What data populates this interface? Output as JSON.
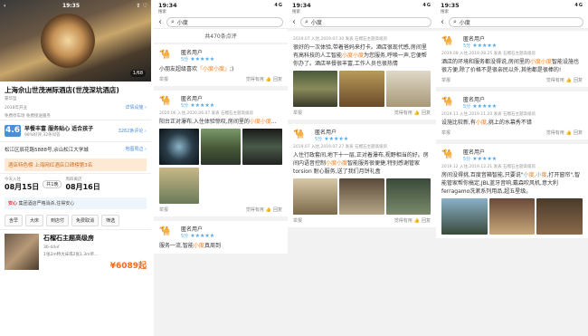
{
  "p1": {
    "time": "19:35",
    "signal": "4G",
    "photo_count": "1/68",
    "title": "上海佘山世茂洲际酒店(世茂深坑酒店)",
    "category": "豪华型",
    "opened": "2018年开业",
    "facilities": "免费停车场  免费接送服务",
    "details_link": "详情设施 ›",
    "score": "4.6",
    "score_tags": "早餐丰富  服务贴心  适合孩子",
    "score_sub": "98%好评,32条问答",
    "reviews_link": "3262条评论 ›",
    "address": "松江区辰花路5888号,佘山松江大学城",
    "map_link": "地图周边 ›",
    "banner": "酒店特色榜  上海网红酒店口碑榜第3名",
    "checkin_label": "今天入住",
    "checkin": "08月15日",
    "nights": "共1晚",
    "checkout_label": "周四离店",
    "checkout": "08月16日",
    "promo": "集团酒店严格消杀,住得安心",
    "promo_badge": "安心",
    "filters": [
      "含早",
      "大床",
      "到店付",
      "免费取消",
      "筛选"
    ],
    "room_name": "石榴石主题高级房",
    "room_size": "36-44㎡",
    "room_beds": "1张2m特大床或2张1.3m单...",
    "room_price": "¥6089起"
  },
  "p2": {
    "time": "19:34",
    "signal": "4G",
    "back_label": "搜索",
    "search_value": "小度",
    "count": "共470条点评",
    "reviews": [
      {
        "user": "匿名用户",
        "rating": "5分",
        "meta": "",
        "text": "小朋友超级喜欢『小度小度』;)",
        "has_imgs": false,
        "likes": "觉得有用",
        "reply": "回复"
      },
      {
        "user": "匿名用户",
        "rating": "5分",
        "meta": "2020.06 入住,2020.06.07 发表  石榴石主题高级房",
        "text": "阳台正对瀑布,入住体验惊叹,房间里的小度小度...",
        "has_imgs": true,
        "likes": "觉得有用",
        "reply": "回复"
      },
      {
        "user": "匿名用户",
        "rating": "5分",
        "meta": "",
        "text": "服务一流,智能小度真周到",
        "has_imgs": false,
        "likes": "觉得有用",
        "reply": "回复"
      }
    ]
  },
  "p3": {
    "time": "19:34",
    "signal": "4G",
    "back_label": "搜索",
    "search_value": "小度",
    "reviews": [
      {
        "user": "",
        "rating": "",
        "meta": "2019.07 入住,2019.07.30 发表  石榴石主题高级房",
        "text": "很好的一次体验,带着爸妈来打卡。酒店很现代感,房间里有高科技的人工智能小度小度为您服务,呼唤一声,它便帮你办了。酒店早餐很丰富,工作人员也很热情",
        "has_imgs": true,
        "likes": "觉得有用",
        "reply": "回复"
      },
      {
        "user": "匿名用户",
        "rating": "5分",
        "meta": "2019.07 入住,2019.07.27 发表  石榴石主题高级房",
        "text": "入住行政套间,地下十一层,正对着瀑布,视野相当的好。房间内语音控制小度小度智能服务很便捷,特别感谢管家 torsion 耐心服务,送了我们月饼礼盒",
        "has_imgs": true,
        "likes": "觉得有用",
        "reply": "回复"
      }
    ]
  },
  "p4": {
    "time": "19:35",
    "signal": "4G",
    "back_label": "搜索",
    "search_value": "小度",
    "reviews": [
      {
        "user": "匿名用户",
        "rating": "5分",
        "meta": "2019.08 入住,2019.08.25 发表  石榴石主题高级房",
        "text": "酒店的环境和服务都没得说,房间里的小度小度智能设施也很方便,除了价格不是很亲民以外,其他都是很棒的!",
        "has_imgs": false,
        "likes": "觉得有用",
        "reply": "回复"
      },
      {
        "user": "匿名用户",
        "rating": "5分",
        "meta": "2019.11 入住,2019.11.20 发表  石榴石主题高级房",
        "text": "设施比较新,有小度,挑上的水幕秀不错",
        "has_imgs": false,
        "likes": "觉得有用",
        "reply": "回复"
      },
      {
        "user": "匿名用户",
        "rating": "5分",
        "meta": "2019.12 入住,2019.12.21 发表  石榴石主题高级房",
        "text": "房间没得挑,百度音箱智能,只要说\"小度,小度,打开窗帘\",智能管家帮你搞定,JBL蓝牙音响,戴森吹风机,意大利ferragamo洗漱系列用品,超五星级。",
        "has_imgs": true,
        "likes": "觉得有用",
        "reply": "回复"
      }
    ]
  }
}
